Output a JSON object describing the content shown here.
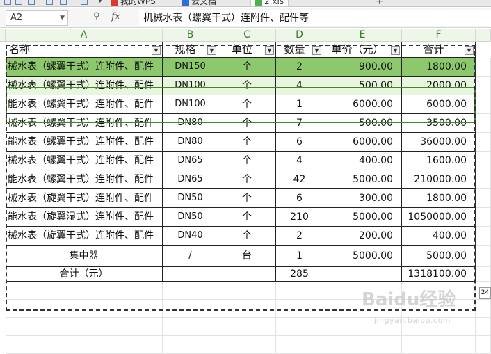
{
  "tabs": [
    {
      "label": "我的WPS"
    },
    {
      "label": "云文档"
    },
    {
      "label": "2.xls"
    }
  ],
  "formula_bar": {
    "name_box": "A2",
    "fx_label": "fx",
    "content": "机械水表（螺翼干式）连附件、配件等"
  },
  "columns": [
    "A",
    "B",
    "C",
    "D",
    "E",
    "F"
  ],
  "header_row": [
    "名称",
    "规格",
    "单位",
    "数量",
    "单价（元）",
    "合计"
  ],
  "rows": [
    [
      "械水表（螺翼干式）连附件、配件",
      "DN150",
      "个",
      "2",
      "900.00",
      "1800.00"
    ],
    [
      "械水表（螺翼干式）连附件、配件",
      "DN100",
      "个",
      "4",
      "500.00",
      "2000.00"
    ],
    [
      "能水表（螺翼干式）连附件、配件",
      "DN100",
      "个",
      "1",
      "6000.00",
      "6000.00"
    ],
    [
      "械水表（螺翼干式）连附件、配件",
      "DN80",
      "个",
      "7",
      "500.00",
      "3500.00"
    ],
    [
      "能水表（螺翼干式）连附件、配件",
      "DN80",
      "个",
      "6",
      "6000.00",
      "36000.00"
    ],
    [
      "械水表（螺翼干式）连附件、配件",
      "DN65",
      "个",
      "4",
      "400.00",
      "1600.00"
    ],
    [
      "能水表（螺翼干式）连附件、配件",
      "DN65",
      "个",
      "42",
      "5000.00",
      "210000.00"
    ],
    [
      "械水表（旋翼干式）连附件、配件",
      "DN50",
      "个",
      "6",
      "300.00",
      "1800.00"
    ],
    [
      "能水表（旋翼湿式）连附件、配件",
      "DN50",
      "个",
      "210",
      "5000.00",
      "1050000.00"
    ],
    [
      "械水表（旋翼干式）连附件、配件",
      "DN40",
      "个",
      "2",
      "200.00",
      "400.00"
    ],
    [
      "集中器",
      "/",
      "台",
      "1",
      "5000.00",
      "5000.00"
    ]
  ],
  "total_row": [
    "合计（元）",
    "",
    "",
    "285",
    "",
    "1318100.00"
  ],
  "tooltip": "24",
  "watermark": {
    "main": "Baidu经验",
    "sub": "jingyan.baidu.com"
  },
  "colors": {
    "selection": "#8dc86d",
    "selection_light": "#e8f5df",
    "header_bg": "#eef6ea",
    "header_text": "#3e7b2f"
  }
}
